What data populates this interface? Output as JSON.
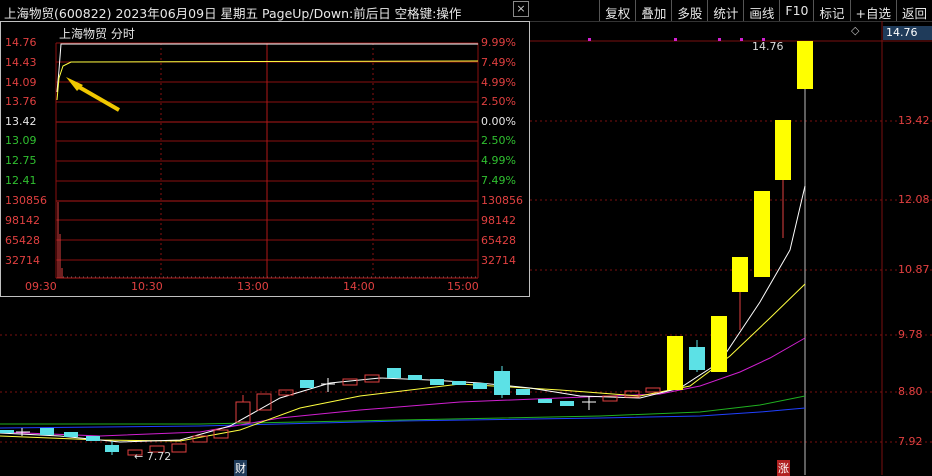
{
  "window": {
    "title": "上海物贸(600822) 2023年06月09日 星期五 PageUp/Down:前后日 空格键:操作",
    "close_label": "×"
  },
  "toolbar": [
    "复权",
    "叠加",
    "多股",
    "统计",
    "画线",
    "F10",
    "标记",
    "+自选",
    "返回"
  ],
  "main_chart": {
    "current_price": "14.76",
    "high_label": "14.76",
    "low_label": "7.72",
    "y_axis_labels": [
      "13.42",
      "12.08",
      "10.87",
      "9.78",
      "8.80",
      "7.92"
    ],
    "bottom_markers": [
      "财",
      "涨"
    ],
    "colors": {
      "up": "#e04040",
      "down": "#5ce1e6",
      "limit_up": "#ffff00",
      "ma_white": "#ffffff",
      "ma_yellow": "#ffff40",
      "ma_magenta": "#d020d0",
      "ma_green": "#20b020",
      "ma_blue": "#2040ff"
    }
  },
  "intraday": {
    "title": "上海物贸  分时",
    "price_labels": [
      "14.76",
      "14.43",
      "14.09",
      "13.76",
      "13.42",
      "13.09",
      "12.75",
      "12.41"
    ],
    "pct_labels": [
      "9.99%",
      "7.49%",
      "4.99%",
      "2.50%",
      "0.00%",
      "2.50%",
      "4.99%",
      "7.49%"
    ],
    "volume_labels": [
      "130856",
      "98142",
      "65428",
      "32714"
    ],
    "time_labels": [
      "09:30",
      "10:30",
      "13:00",
      "14:00",
      "15:00"
    ]
  }
}
